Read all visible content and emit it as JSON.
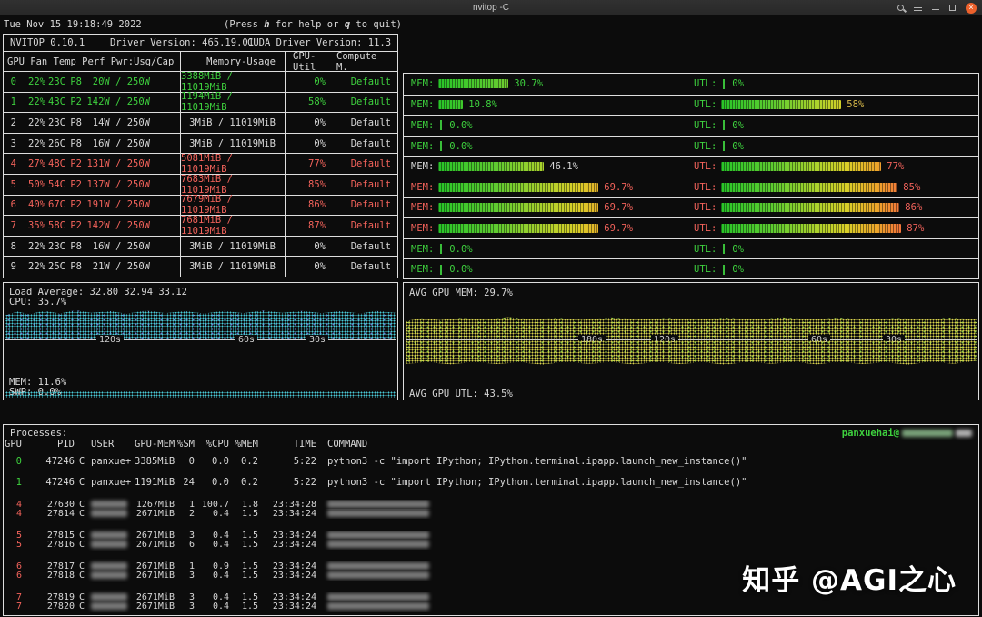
{
  "window": {
    "title": "nvitop -C",
    "close_glyph": "×"
  },
  "topbar": {
    "datetime": "Tue Nov 15 19:18:49 2022",
    "help_pre": "(Press ",
    "help_key1": "h",
    "help_mid": " for help or ",
    "help_key2": "q",
    "help_post": " to quit)"
  },
  "nvitop_header": {
    "app": "NVITOP 0.10.1",
    "driver": "Driver Version: 465.19.01",
    "cuda": "CUDA Driver Version: 11.3"
  },
  "table_header": {
    "left": "GPU Fan Temp Perf Pwr:Usg/Cap",
    "memory": "Memory-Usage",
    "util": "GPU-Util",
    "compute": "Compute M."
  },
  "gpus": [
    {
      "idx": "0",
      "fan": "22%",
      "temp": "23C",
      "perf": "P8",
      "power": "20W / 250W",
      "memory": "3388MiB / 11019MiB",
      "util": "0%",
      "compute": "Default",
      "row_color": "green",
      "mem_pct": 30.7,
      "mem_label": "30.7%",
      "mem_color": "green",
      "utl_pct": 0,
      "utl_label": "0%",
      "utl_color": "green"
    },
    {
      "idx": "1",
      "fan": "22%",
      "temp": "43C",
      "perf": "P2",
      "power": "142W / 250W",
      "memory": "1194MiB / 11019MiB",
      "util": "58%",
      "compute": "Default",
      "row_color": "green",
      "mem_pct": 10.8,
      "mem_label": "10.8%",
      "mem_color": "green",
      "utl_pct": 58,
      "utl_label": "58%",
      "utl_color": "green",
      "utl_pct_color": "yellow"
    },
    {
      "idx": "2",
      "fan": "22%",
      "temp": "23C",
      "perf": "P8",
      "power": "14W / 250W",
      "memory": "3MiB / 11019MiB",
      "util": "0%",
      "compute": "Default",
      "row_color": "white",
      "mem_pct": 0,
      "mem_label": "0.0%",
      "mem_color": "green",
      "utl_pct": 0,
      "utl_label": "0%",
      "utl_color": "green"
    },
    {
      "idx": "3",
      "fan": "22%",
      "temp": "26C",
      "perf": "P8",
      "power": "16W / 250W",
      "memory": "3MiB / 11019MiB",
      "util": "0%",
      "compute": "Default",
      "row_color": "white",
      "mem_pct": 0,
      "mem_label": "0.0%",
      "mem_color": "green",
      "utl_pct": 0,
      "utl_label": "0%",
      "utl_color": "green"
    },
    {
      "idx": "4",
      "fan": "27%",
      "temp": "48C",
      "perf": "P2",
      "power": "131W / 250W",
      "memory": "5081MiB / 11019MiB",
      "util": "77%",
      "compute": "Default",
      "row_color": "red",
      "mem_pct": 46.1,
      "mem_label": "46.1%",
      "mem_color": "white",
      "utl_pct": 77,
      "utl_label": "77%",
      "utl_color": "red"
    },
    {
      "idx": "5",
      "fan": "50%",
      "temp": "54C",
      "perf": "P2",
      "power": "137W / 250W",
      "memory": "7683MiB / 11019MiB",
      "util": "85%",
      "compute": "Default",
      "row_color": "red",
      "mem_pct": 69.7,
      "mem_label": "69.7%",
      "mem_color": "red",
      "utl_pct": 85,
      "utl_label": "85%",
      "utl_color": "red"
    },
    {
      "idx": "6",
      "fan": "40%",
      "temp": "67C",
      "perf": "P2",
      "power": "191W / 250W",
      "memory": "7679MiB / 11019MiB",
      "util": "86%",
      "compute": "Default",
      "row_color": "red",
      "mem_pct": 69.7,
      "mem_label": "69.7%",
      "mem_color": "red",
      "utl_pct": 86,
      "utl_label": "86%",
      "utl_color": "red"
    },
    {
      "idx": "7",
      "fan": "35%",
      "temp": "58C",
      "perf": "P2",
      "power": "142W / 250W",
      "memory": "7681MiB / 11019MiB",
      "util": "87%",
      "compute": "Default",
      "row_color": "red",
      "mem_pct": 69.7,
      "mem_label": "69.7%",
      "mem_color": "red",
      "utl_pct": 87,
      "utl_label": "87%",
      "utl_color": "red"
    },
    {
      "idx": "8",
      "fan": "22%",
      "temp": "23C",
      "perf": "P8",
      "power": "16W / 250W",
      "memory": "3MiB / 11019MiB",
      "util": "0%",
      "compute": "Default",
      "row_color": "white",
      "mem_pct": 0,
      "mem_label": "0.0%",
      "mem_color": "green",
      "utl_pct": 0,
      "utl_label": "0%",
      "utl_color": "green"
    },
    {
      "idx": "9",
      "fan": "22%",
      "temp": "25C",
      "perf": "P8",
      "power": "21W / 250W",
      "memory": "3MiB / 11019MiB",
      "util": "0%",
      "compute": "Default",
      "row_color": "white",
      "mem_pct": 0,
      "mem_label": "0.0%",
      "mem_color": "green",
      "utl_pct": 0,
      "utl_label": "0%",
      "utl_color": "green"
    }
  ],
  "meter_labels": {
    "mem": "MEM:",
    "utl": "UTL:"
  },
  "cpu_panel": {
    "load_average": "Load Average: 32.80 32.94 33.12",
    "cpu": "CPU: 35.7%",
    "mem": "MEM: 11.6%",
    "swp": "SWP: 0.0%",
    "ticks": [
      "120s",
      "60s",
      "30s"
    ]
  },
  "gpu_panel": {
    "avg_mem": "AVG GPU MEM: 29.7%",
    "avg_utl": "AVG GPU UTL: 43.5%",
    "ticks": [
      "180s",
      "120s",
      "60s",
      "30s"
    ]
  },
  "processes": {
    "title": "Processes:",
    "user_host": "panxuehai@",
    "columns": [
      "GPU",
      "PID",
      "USER",
      "GPU-MEM",
      "%SM",
      "%CPU",
      "%MEM",
      "TIME",
      "COMMAND"
    ],
    "rows": [
      {
        "gpu": "0",
        "pid": "47246",
        "type": "C",
        "user": "panxue+",
        "mem": "3385MiB",
        "sm": "0",
        "cpu": "0.0",
        "pmem": "0.2",
        "time": "5:22",
        "command": "python3 -c \"import IPython; IPython.terminal.ipapp.launch_new_instance()\"",
        "color": "green",
        "redacted": false
      },
      {
        "gpu": "1",
        "pid": "47246",
        "type": "C",
        "user": "panxue+",
        "mem": "1191MiB",
        "sm": "24",
        "cpu": "0.0",
        "pmem": "0.2",
        "time": "5:22",
        "command": "python3 -c \"import IPython; IPython.terminal.ipapp.launch_new_instance()\"",
        "color": "green",
        "redacted": false
      },
      {
        "gpu": "4",
        "pid": "27630",
        "type": "C",
        "user": "",
        "mem": "1267MiB",
        "sm": "1",
        "cpu": "100.7",
        "pmem": "1.8",
        "time": "23:34:28",
        "command": "",
        "color": "red",
        "redacted": true
      },
      {
        "gpu": "4",
        "pid": "27814",
        "type": "C",
        "user": "",
        "mem": "2671MiB",
        "sm": "2",
        "cpu": "0.4",
        "pmem": "1.5",
        "time": "23:34:24",
        "command": "",
        "color": "red",
        "redacted": true
      },
      {
        "gpu": "5",
        "pid": "27815",
        "type": "C",
        "user": "",
        "mem": "2671MiB",
        "sm": "3",
        "cpu": "0.4",
        "pmem": "1.5",
        "time": "23:34:24",
        "command": "",
        "color": "red",
        "redacted": true
      },
      {
        "gpu": "5",
        "pid": "27816",
        "type": "C",
        "user": "",
        "mem": "2671MiB",
        "sm": "6",
        "cpu": "0.4",
        "pmem": "1.5",
        "time": "23:34:24",
        "command": "",
        "color": "red",
        "redacted": true
      },
      {
        "gpu": "6",
        "pid": "27817",
        "type": "C",
        "user": "",
        "mem": "2671MiB",
        "sm": "1",
        "cpu": "0.9",
        "pmem": "1.5",
        "time": "23:34:24",
        "command": "",
        "color": "red",
        "redacted": true
      },
      {
        "gpu": "6",
        "pid": "27818",
        "type": "C",
        "user": "",
        "mem": "2671MiB",
        "sm": "3",
        "cpu": "0.4",
        "pmem": "1.5",
        "time": "23:34:24",
        "command": "",
        "color": "red",
        "redacted": true
      },
      {
        "gpu": "7",
        "pid": "27819",
        "type": "C",
        "user": "",
        "mem": "2671MiB",
        "sm": "3",
        "cpu": "0.4",
        "pmem": "1.5",
        "time": "23:34:24",
        "command": "",
        "color": "red",
        "redacted": true
      },
      {
        "gpu": "7",
        "pid": "27820",
        "type": "C",
        "user": "",
        "mem": "2671MiB",
        "sm": "3",
        "cpu": "0.4",
        "pmem": "1.5",
        "time": "23:34:24",
        "command": "",
        "color": "red",
        "redacted": true
      }
    ]
  },
  "watermark": {
    "text": "知乎 @AGI之心"
  },
  "colors": {
    "green": "#3ed13e",
    "red": "#f4635b",
    "yellow": "#d8b94a",
    "white": "#d8d8d8",
    "close_button": "#ec612c",
    "cyan_graph": "#49c9d6",
    "yellow_graph": "#d8d24c"
  }
}
